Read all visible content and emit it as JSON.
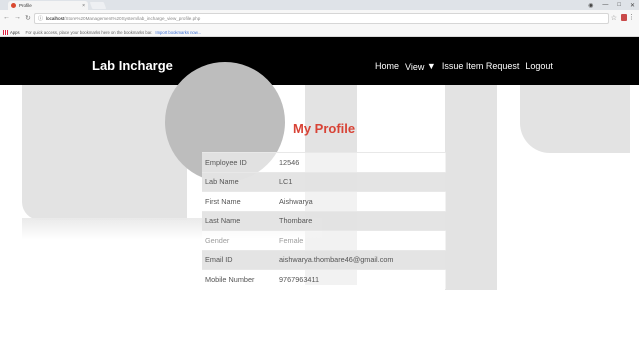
{
  "browser": {
    "tab_title": "Profile",
    "tab_close": "×",
    "url_host": "localhost",
    "url_path": "/Store%20Management%20System/lab_incharge_view_profile.php",
    "bookmarks_apps": "Apps",
    "bookmarks_hint": "For quick access, place your bookmarks here on the bookmarks bar.",
    "bookmarks_import": "Import bookmarks now..."
  },
  "navbar": {
    "brand": "Lab Incharge",
    "menu": [
      "Home",
      "View",
      "Issue Item Request",
      "Logout"
    ]
  },
  "page": {
    "title": "My Profile",
    "fields": [
      {
        "label": "Employee ID",
        "value": "12546"
      },
      {
        "label": "Lab Name",
        "value": "LC1"
      },
      {
        "label": "First Name",
        "value": "Aishwarya"
      },
      {
        "label": "Last Name",
        "value": "Thombare"
      },
      {
        "label": "Gender",
        "value": "Female"
      },
      {
        "label": "Email ID",
        "value": "aishwarya.thombare46@gmail.com"
      },
      {
        "label": "Mobile Number",
        "value": "9767963411"
      }
    ]
  },
  "colors": {
    "navbar_bg": "#000000",
    "heading": "#d84336",
    "row_shade": "#e2e2e2"
  },
  "icons": [
    "back-icon",
    "forward-icon",
    "reload-icon",
    "home-icon",
    "info-icon",
    "star-icon",
    "extension-icon",
    "menu-icon",
    "caret-down-icon"
  ]
}
